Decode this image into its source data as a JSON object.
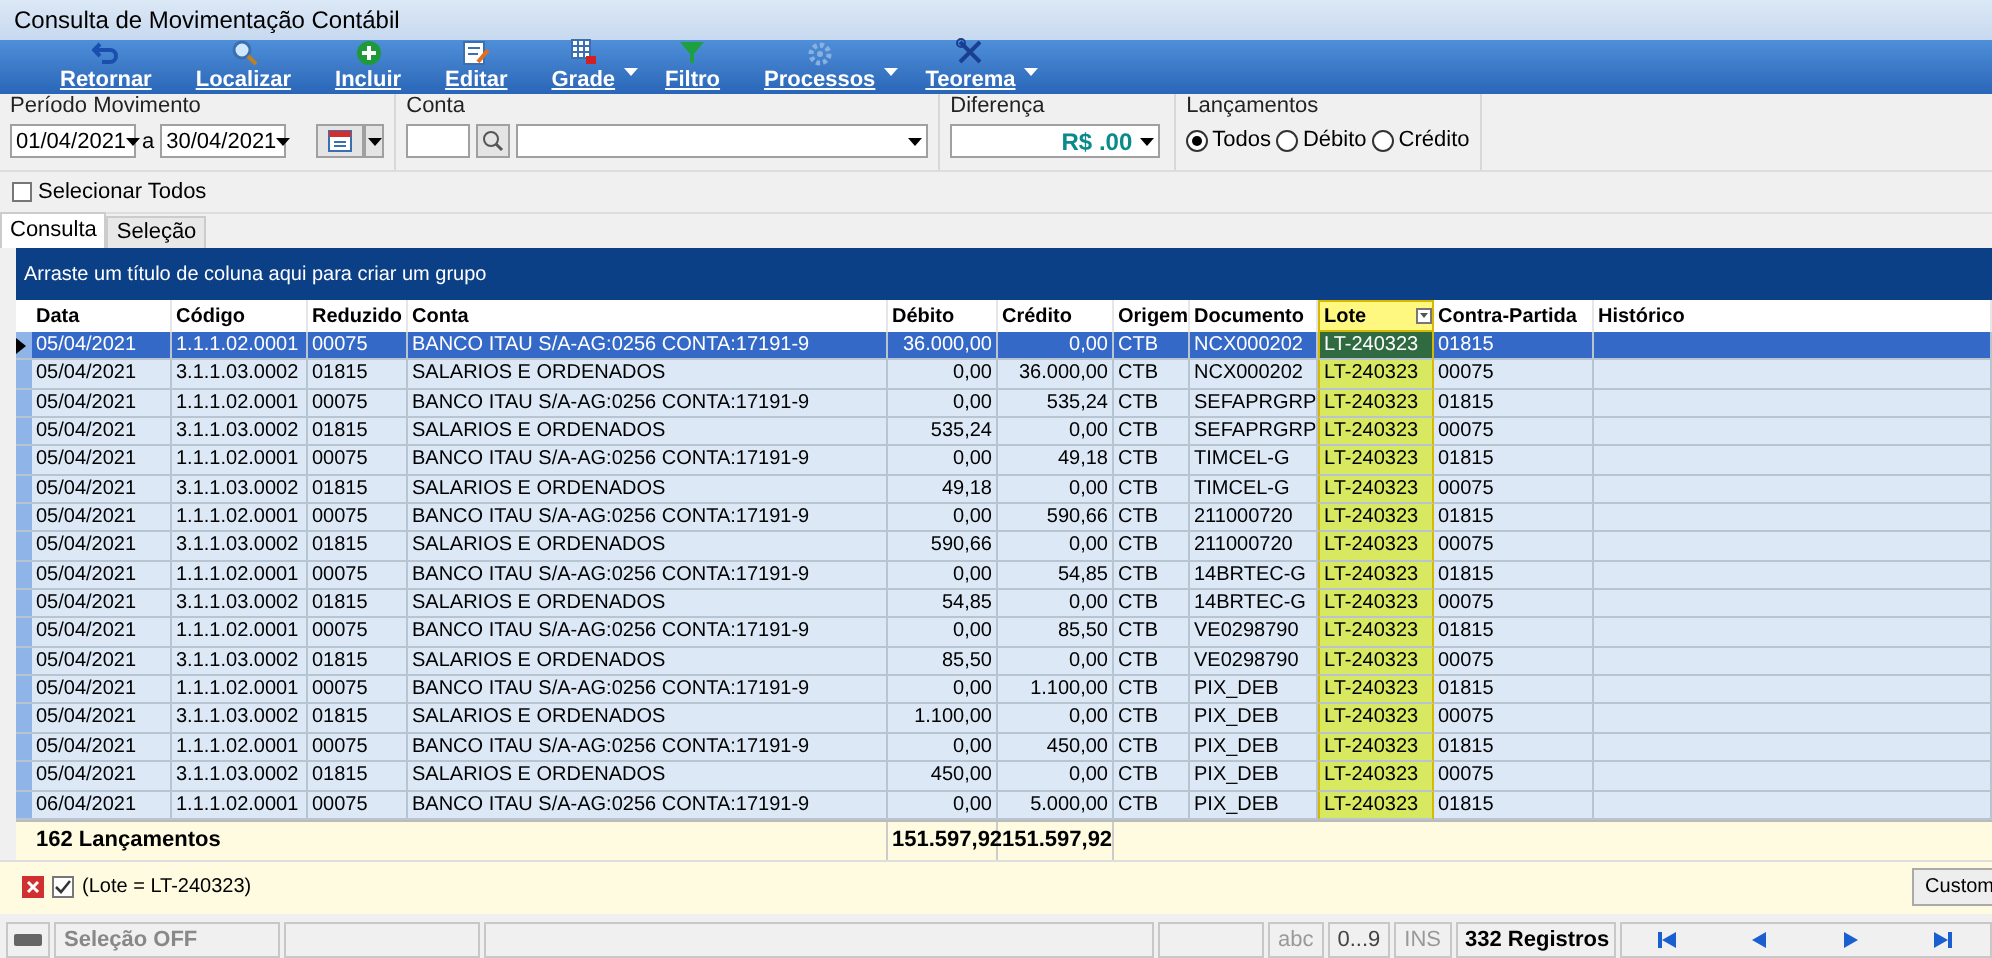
{
  "window": {
    "title": "Consulta de Movimentação Contábil"
  },
  "toolbar": [
    {
      "label": "Retornar",
      "has_menu": false
    },
    {
      "label": "Localizar",
      "has_menu": false
    },
    {
      "label": "Incluir",
      "has_menu": false
    },
    {
      "label": "Editar",
      "has_menu": false
    },
    {
      "label": "Grade",
      "has_menu": true
    },
    {
      "label": "Filtro",
      "has_menu": false
    },
    {
      "label": "Processos",
      "has_menu": true
    },
    {
      "label": "Teorema",
      "has_menu": true
    }
  ],
  "periodo": {
    "label": "Período Movimento",
    "from": "01/04/2021",
    "separator": "a",
    "to": "30/04/2021"
  },
  "conta": {
    "label": "Conta"
  },
  "diferenca": {
    "label": "Diferença",
    "value": "R$ .00"
  },
  "lancamentos": {
    "label": "Lançamentos",
    "options": [
      {
        "label": "Todos",
        "selected": true
      },
      {
        "label": "Débito",
        "selected": false
      },
      {
        "label": "Crédito",
        "selected": false
      }
    ]
  },
  "select_all": {
    "label": "Selecionar Todos",
    "checked": false
  },
  "tabs": [
    {
      "label": "Consulta",
      "selected": true
    },
    {
      "label": "Seleção",
      "selected": false
    }
  ],
  "group_panel": "Arraste um título de coluna aqui para criar um grupo",
  "columns": [
    {
      "label": "Data",
      "filtered": false
    },
    {
      "label": "Código",
      "filtered": false
    },
    {
      "label": "Reduzido",
      "filtered": false
    },
    {
      "label": "Conta",
      "filtered": false
    },
    {
      "label": "Débito",
      "filtered": false
    },
    {
      "label": "Crédito",
      "filtered": false
    },
    {
      "label": "Origem",
      "filtered": false
    },
    {
      "label": "Documento",
      "filtered": false
    },
    {
      "label": "Lote",
      "filtered": true
    },
    {
      "label": "Contra-Partida",
      "filtered": false
    },
    {
      "label": "Histórico",
      "filtered": false
    }
  ],
  "rows": [
    {
      "selected": true,
      "cells": [
        "05/04/2021",
        "1.1.1.02.0001",
        "00075",
        "BANCO ITAU S/A-AG:0256 CONTA:17191-9",
        "36.000,00",
        "0,00",
        "CTB",
        "NCX000202",
        "LT-240323",
        "01815"
      ]
    },
    {
      "selected": false,
      "cells": [
        "05/04/2021",
        "3.1.1.03.0002",
        "01815",
        "SALARIOS E ORDENADOS",
        "0,00",
        "36.000,00",
        "CTB",
        "NCX000202",
        "LT-240323",
        "00075"
      ]
    },
    {
      "selected": false,
      "cells": [
        "05/04/2021",
        "1.1.1.02.0001",
        "00075",
        "BANCO ITAU S/A-AG:0256 CONTA:17191-9",
        "0,00",
        "535,24",
        "CTB",
        "SEFAPRGRP",
        "LT-240323",
        "01815"
      ]
    },
    {
      "selected": false,
      "cells": [
        "05/04/2021",
        "3.1.1.03.0002",
        "01815",
        "SALARIOS E ORDENADOS",
        "535,24",
        "0,00",
        "CTB",
        "SEFAPRGRP",
        "LT-240323",
        "00075"
      ]
    },
    {
      "selected": false,
      "cells": [
        "05/04/2021",
        "1.1.1.02.0001",
        "00075",
        "BANCO ITAU S/A-AG:0256 CONTA:17191-9",
        "0,00",
        "49,18",
        "CTB",
        "TIMCEL-G",
        "LT-240323",
        "01815"
      ]
    },
    {
      "selected": false,
      "cells": [
        "05/04/2021",
        "3.1.1.03.0002",
        "01815",
        "SALARIOS E ORDENADOS",
        "49,18",
        "0,00",
        "CTB",
        "TIMCEL-G",
        "LT-240323",
        "00075"
      ]
    },
    {
      "selected": false,
      "cells": [
        "05/04/2021",
        "1.1.1.02.0001",
        "00075",
        "BANCO ITAU S/A-AG:0256 CONTA:17191-9",
        "0,00",
        "590,66",
        "CTB",
        "211000720",
        "LT-240323",
        "01815"
      ]
    },
    {
      "selected": false,
      "cells": [
        "05/04/2021",
        "3.1.1.03.0002",
        "01815",
        "SALARIOS E ORDENADOS",
        "590,66",
        "0,00",
        "CTB",
        "211000720",
        "LT-240323",
        "00075"
      ]
    },
    {
      "selected": false,
      "cells": [
        "05/04/2021",
        "1.1.1.02.0001",
        "00075",
        "BANCO ITAU S/A-AG:0256 CONTA:17191-9",
        "0,00",
        "54,85",
        "CTB",
        "14BRTEC-G",
        "LT-240323",
        "01815"
      ]
    },
    {
      "selected": false,
      "cells": [
        "05/04/2021",
        "3.1.1.03.0002",
        "01815",
        "SALARIOS E ORDENADOS",
        "54,85",
        "0,00",
        "CTB",
        "14BRTEC-G",
        "LT-240323",
        "00075"
      ]
    },
    {
      "selected": false,
      "cells": [
        "05/04/2021",
        "1.1.1.02.0001",
        "00075",
        "BANCO ITAU S/A-AG:0256 CONTA:17191-9",
        "0,00",
        "85,50",
        "CTB",
        "VE0298790",
        "LT-240323",
        "01815"
      ]
    },
    {
      "selected": false,
      "cells": [
        "05/04/2021",
        "3.1.1.03.0002",
        "01815",
        "SALARIOS E ORDENADOS",
        "85,50",
        "0,00",
        "CTB",
        "VE0298790",
        "LT-240323",
        "00075"
      ]
    },
    {
      "selected": false,
      "cells": [
        "05/04/2021",
        "1.1.1.02.0001",
        "00075",
        "BANCO ITAU S/A-AG:0256 CONTA:17191-9",
        "0,00",
        "1.100,00",
        "CTB",
        "PIX_DEB",
        "LT-240323",
        "01815"
      ]
    },
    {
      "selected": false,
      "cells": [
        "05/04/2021",
        "3.1.1.03.0002",
        "01815",
        "SALARIOS E ORDENADOS",
        "1.100,00",
        "0,00",
        "CTB",
        "PIX_DEB",
        "LT-240323",
        "00075"
      ]
    },
    {
      "selected": false,
      "cells": [
        "05/04/2021",
        "1.1.1.02.0001",
        "00075",
        "BANCO ITAU S/A-AG:0256 CONTA:17191-9",
        "0,00",
        "450,00",
        "CTB",
        "PIX_DEB",
        "LT-240323",
        "01815"
      ]
    },
    {
      "selected": false,
      "cells": [
        "05/04/2021",
        "3.1.1.03.0002",
        "01815",
        "SALARIOS E ORDENADOS",
        "450,00",
        "0,00",
        "CTB",
        "PIX_DEB",
        "LT-240323",
        "00075"
      ]
    },
    {
      "selected": false,
      "cells": [
        "06/04/2021",
        "1.1.1.02.0001",
        "00075",
        "BANCO ITAU S/A-AG:0256 CONTA:17191-9",
        "0,00",
        "5.000,00",
        "CTB",
        "PIX_DEB",
        "LT-240323",
        "01815"
      ]
    }
  ],
  "footer": {
    "count": "162 Lançamentos",
    "debito": "151.597,92",
    "credito": "151.597,92"
  },
  "filter_bar": {
    "active": true,
    "text": "(Lote = LT-240323)",
    "button": "Custom"
  },
  "status_bar": {
    "selection": "Seleção OFF",
    "abc": "abc",
    "digits": "0...9",
    "ins": "INS",
    "records": "332 Registros"
  }
}
